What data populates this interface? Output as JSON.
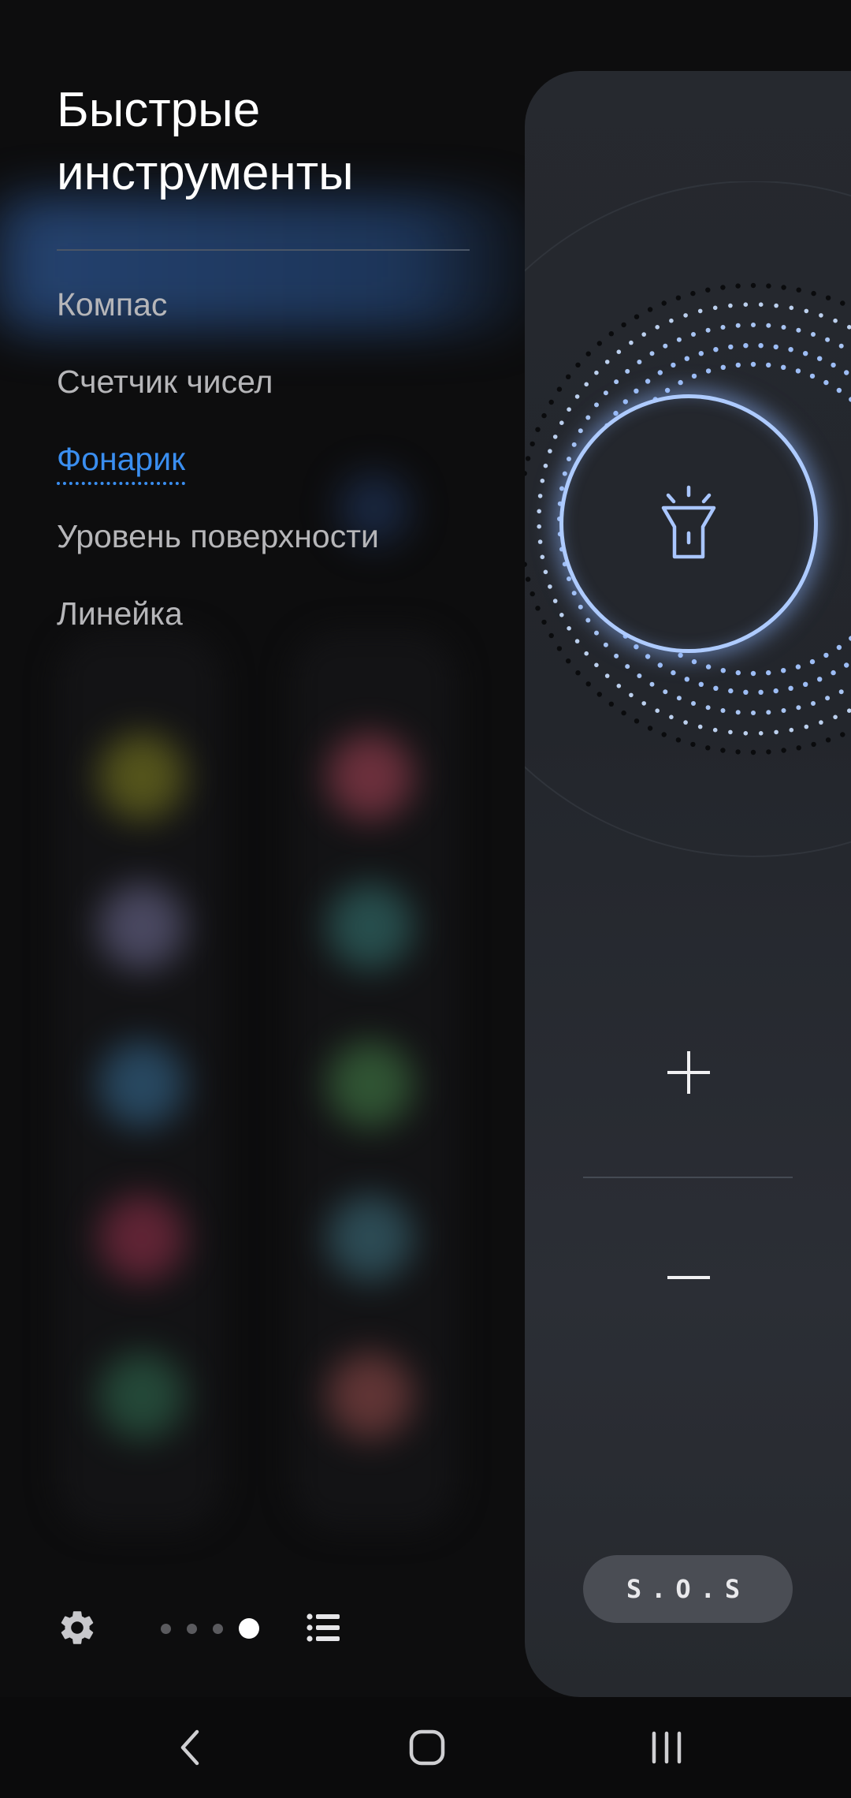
{
  "menu": {
    "title": "Быстрые инструменты",
    "items": [
      {
        "label": "Компас",
        "active": false
      },
      {
        "label": "Счетчик чисел",
        "active": false
      },
      {
        "label": "Фонарик",
        "active": true
      },
      {
        "label": "Уровень поверхности",
        "active": false
      },
      {
        "label": "Линейка",
        "active": false
      }
    ],
    "page_indicator": {
      "total": 4,
      "current": 4
    }
  },
  "flashlight": {
    "icon": "flashlight-icon",
    "sos_label": "S.O.S"
  },
  "icons": {
    "settings": "gear-icon",
    "list": "list-icon",
    "plus": "plus-icon",
    "minus": "minus-icon",
    "back": "back-icon",
    "home": "home-icon",
    "recents": "recents-icon"
  },
  "colors": {
    "accent": "#3a8ef0",
    "ring": "#aecbff",
    "panel": "#26292f"
  }
}
